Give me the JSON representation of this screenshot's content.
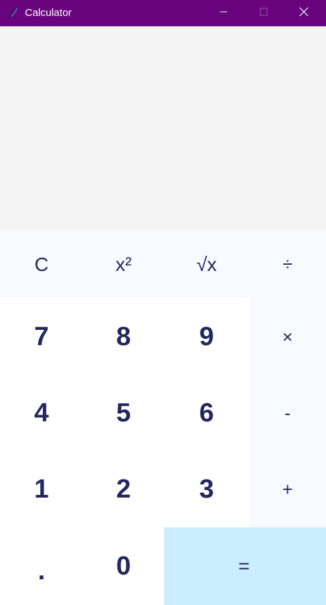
{
  "window": {
    "title": "Calculator",
    "titlebar_color": "#6a047e",
    "icon": "feather-icon",
    "controls": {
      "minimize_icon": "minimize-icon",
      "maximize_icon": "maximize-icon",
      "close_icon": "close-icon"
    }
  },
  "display": {
    "value": "",
    "background": "#f4f4f4"
  },
  "keypad": {
    "clear": "C",
    "square": "x²",
    "sqrt": "√x",
    "divide": "÷",
    "multiply": "×",
    "subtract": "-",
    "add": "+",
    "equals": "=",
    "decimal": ".",
    "digits": {
      "d0": "0",
      "d1": "1",
      "d2": "2",
      "d3": "3",
      "d4": "4",
      "d5": "5",
      "d6": "6",
      "d7": "7",
      "d8": "8",
      "d9": "9"
    }
  },
  "colors": {
    "text": "#25265e",
    "operator_bg": "#f8faff",
    "digit_bg": "#ffffff",
    "equals_bg": "#ccedff"
  }
}
